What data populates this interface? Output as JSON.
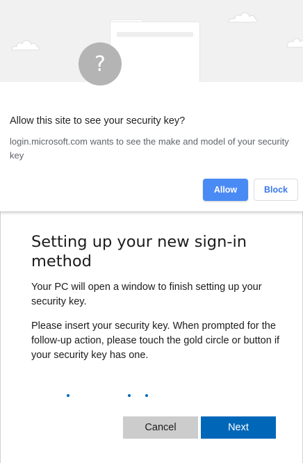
{
  "permission_prompt": {
    "title": "Allow this site to see your security key?",
    "message": "login.microsoft.com wants to see the make and model of your security key",
    "allow_label": "Allow",
    "block_label": "Block",
    "illustration_icon": "question-mark-icon",
    "illustration_glyph": "?"
  },
  "setup_dialog": {
    "title": "Setting up your new sign-in method",
    "paragraph_1": "Your PC will open a window to finish setting up your security key.",
    "paragraph_2": "Please insert your security key. When prompted for the follow-up action, please touch the gold circle or button if your security key has one.",
    "cancel_label": "Cancel",
    "next_label": "Next"
  },
  "colors": {
    "allow_button": "#4a8af4",
    "block_text": "#3b78e7",
    "next_button": "#0067b8",
    "cancel_button": "#cccccc",
    "progress_dots": "#0067b8"
  }
}
